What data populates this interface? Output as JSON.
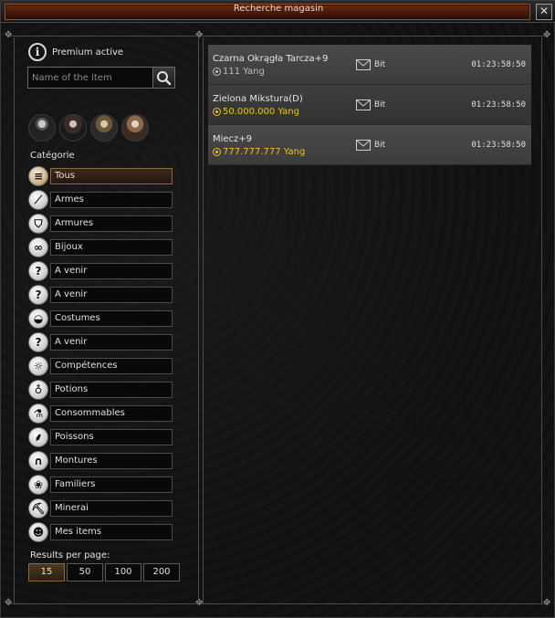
{
  "window": {
    "title": "Recherche magasin",
    "close_glyph": "✕"
  },
  "premium": {
    "text": "Premium active",
    "icon": "info-icon"
  },
  "search": {
    "placeholder": "Name of the item",
    "value": ""
  },
  "portraits": [
    {
      "icon": "warrior-portrait"
    },
    {
      "icon": "assassin-portrait"
    },
    {
      "icon": "sura-portrait"
    },
    {
      "icon": "shaman-portrait"
    }
  ],
  "category_label": "Catégorie",
  "categories": [
    {
      "label": "Tous",
      "icon": "list-icon",
      "glyph": "≡",
      "selected": true
    },
    {
      "label": "Armes",
      "icon": "sword-icon",
      "glyph": "⟋",
      "selected": false
    },
    {
      "label": "Armures",
      "icon": "shield-icon",
      "glyph": "⛉",
      "selected": false
    },
    {
      "label": "Bijoux",
      "icon": "jewel-icon",
      "glyph": "∞",
      "selected": false
    },
    {
      "label": "A venir",
      "icon": "question-icon",
      "glyph": "?",
      "selected": false
    },
    {
      "label": "A venir",
      "icon": "question-icon",
      "glyph": "?",
      "selected": false
    },
    {
      "label": "Costumes",
      "icon": "mask-icon",
      "glyph": "◒",
      "selected": false
    },
    {
      "label": "A venir",
      "icon": "question-icon",
      "glyph": "?",
      "selected": false
    },
    {
      "label": "Compétences",
      "icon": "skill-book-icon",
      "glyph": "☼",
      "selected": false
    },
    {
      "label": "Potions",
      "icon": "potion-icon",
      "glyph": "♁",
      "selected": false
    },
    {
      "label": "Consommables",
      "icon": "flask-icon",
      "glyph": "⚗",
      "selected": false
    },
    {
      "label": "Poissons",
      "icon": "fishing-rod-icon",
      "glyph": "⸙",
      "selected": false
    },
    {
      "label": "Montures",
      "icon": "horseshoe-icon",
      "glyph": "∩",
      "selected": false
    },
    {
      "label": "Familiers",
      "icon": "paw-icon",
      "glyph": "❀",
      "selected": false
    },
    {
      "label": "Minerai",
      "icon": "pickaxe-icon",
      "glyph": "⛏",
      "selected": false
    },
    {
      "label": "Mes items",
      "icon": "user-icon",
      "glyph": "☻",
      "selected": false
    }
  ],
  "results_per_page": {
    "label": "Results per page:",
    "options": [
      "15",
      "50",
      "100",
      "200"
    ],
    "selected": "15"
  },
  "items": [
    {
      "name": "Czarna Okrągła Tarcza+9",
      "price": "111 Yang",
      "price_color": "#bdbdbd",
      "seller": "Bit",
      "time": "01:23:58:50"
    },
    {
      "name": "Zielona Mikstura(D)",
      "price": "50.000.000 Yang",
      "price_color": "#f0c020",
      "seller": "Bit",
      "time": "01:23:58:50"
    },
    {
      "name": "Miecz+9",
      "price": "777.777.777 Yang",
      "price_color": "#f0c020",
      "seller": "Bit",
      "time": "01:23:58:50"
    }
  ]
}
